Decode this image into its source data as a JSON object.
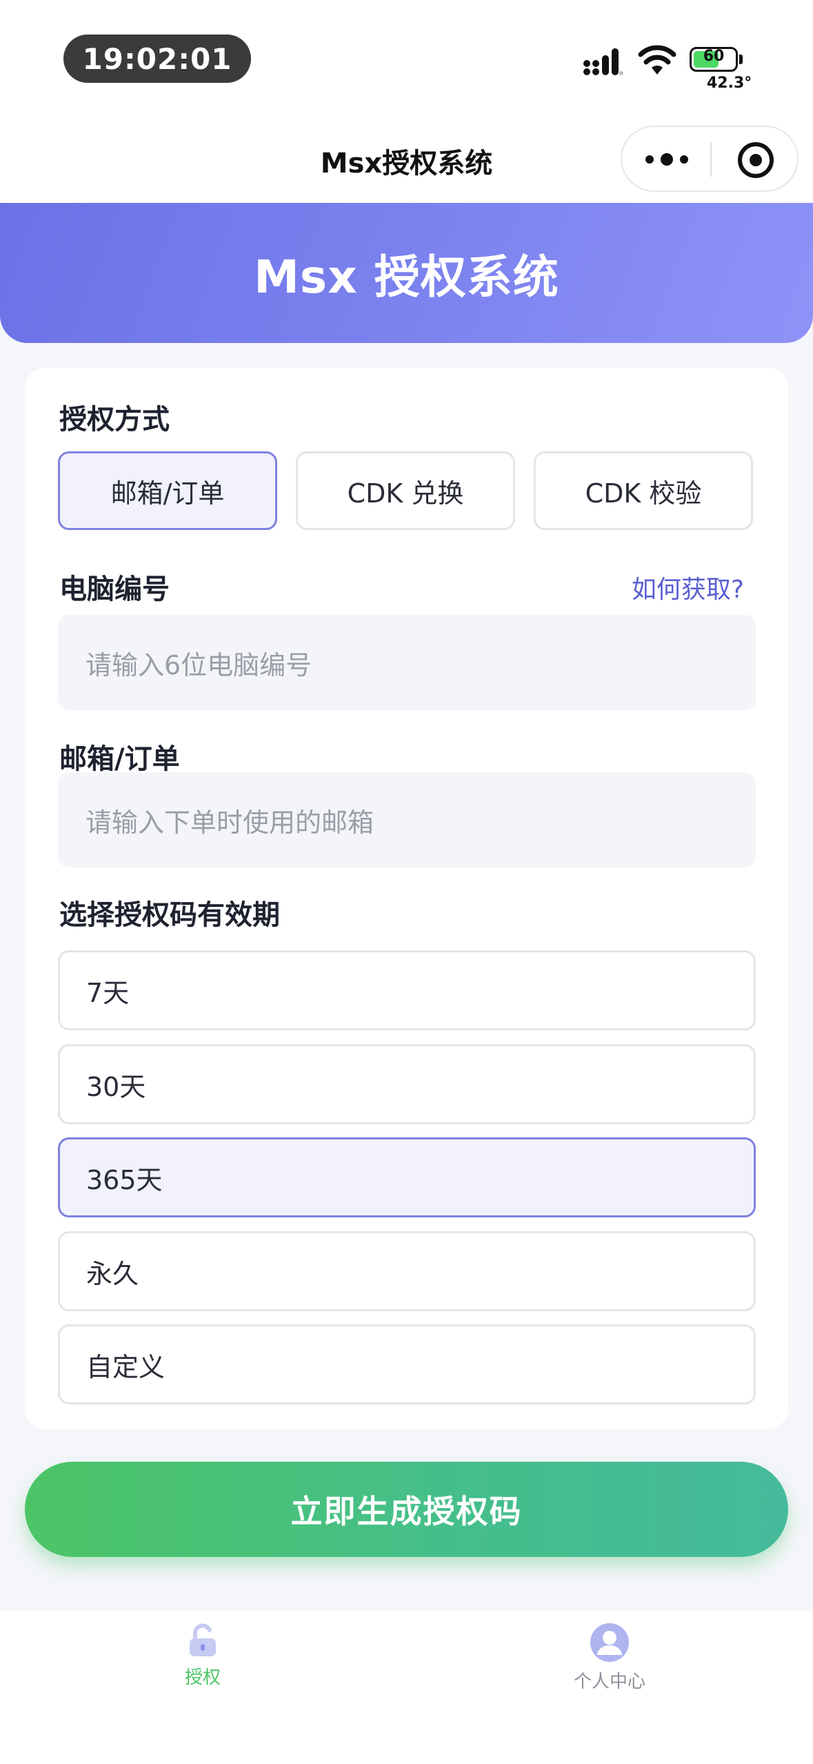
{
  "status_bar": {
    "time": "19:02:01",
    "battery_level": "60",
    "temperature": "42.3°"
  },
  "nav": {
    "title": "Msx授权系统",
    "more_icon": "more-dots-icon",
    "close_icon": "target-circle-icon"
  },
  "banner": {
    "title": "Msx 授权系统"
  },
  "form": {
    "method_label": "授权方式",
    "methods": [
      {
        "label": "邮箱/订单",
        "selected": true
      },
      {
        "label": "CDK 兑换",
        "selected": false
      },
      {
        "label": "CDK 校验",
        "selected": false
      }
    ],
    "pc_label": "电脑编号",
    "pc_help": "如何获取?",
    "pc_placeholder": "请输入6位电脑编号",
    "email_label": "邮箱/订单",
    "email_placeholder": "请输入下单时使用的邮箱",
    "validity_label": "选择授权码有效期",
    "validity_options": [
      {
        "label": "7天",
        "selected": false
      },
      {
        "label": "30天",
        "selected": false
      },
      {
        "label": "365天",
        "selected": true
      },
      {
        "label": "永久",
        "selected": false
      },
      {
        "label": "自定义",
        "selected": false
      }
    ]
  },
  "generate_button": "立即生成授权码",
  "tabbar": {
    "items": [
      {
        "label": "授权",
        "icon": "unlock-icon",
        "active": true
      },
      {
        "label": "个人中心",
        "icon": "user-avatar-icon",
        "active": false
      }
    ]
  },
  "colors": {
    "accent": "#6c72e6",
    "selected_border": "#7e82dd",
    "generate_green": "#4cc466",
    "link": "#5a5fd0"
  }
}
